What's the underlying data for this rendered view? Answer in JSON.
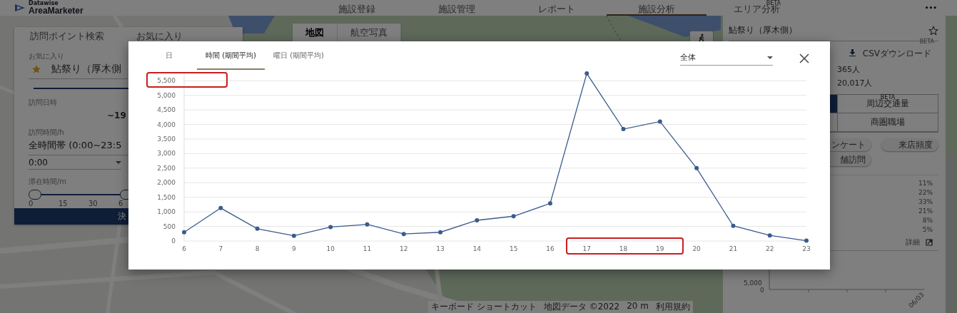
{
  "header": {
    "logo": {
      "tagline": "Datawise",
      "name": "AreaMarketer"
    },
    "nav": [
      {
        "label": "施設登録",
        "selected": false
      },
      {
        "label": "施設管理",
        "selected": false
      },
      {
        "label": "レポート",
        "selected": false
      },
      {
        "label": "施設分析",
        "selected": true
      },
      {
        "label": "エリア分析",
        "badge": "BETA",
        "selected": false
      }
    ],
    "more": "•••"
  },
  "map": {
    "view_toggle": [
      {
        "label": "地図",
        "selected": true
      },
      {
        "label": "航空写真",
        "selected": false
      }
    ],
    "attribution": [
      "キーボード ショートカット",
      "地図データ ©2022",
      "20 m",
      "利用規約"
    ]
  },
  "search_panel": {
    "tabs": [
      "訪問ポイント検索",
      "お気に入り"
    ],
    "favorite": {
      "label": "お気に入り",
      "value": "鮎祭り（厚木側"
    },
    "visit_date": {
      "label": "訪問日時",
      "value": "~19"
    },
    "visit_hours": {
      "label": "訪問時間/h",
      "value": "全時間帯 (0:00~23:5",
      "start": "0:00"
    },
    "stay_minutes": {
      "label": "滞在時間/m",
      "ticks": [
        "0",
        "15",
        "30",
        "6"
      ]
    },
    "submit": "決"
  },
  "facility_panel": {
    "title": "鮎祭り（厚木側）",
    "csv": {
      "label": "CSVダウンロード",
      "badge": "BETA"
    },
    "stats": [
      "365人",
      "20,017人"
    ],
    "tabs": [
      {
        "label": "周辺交通量",
        "badge": "BETA"
      },
      {
        "label": "商圏職場"
      }
    ],
    "chips": [
      "ンケート",
      "来店頻度",
      "舗訪問"
    ],
    "percentages": [
      "11%",
      "22%",
      "33%",
      "21%",
      "8%",
      "5%"
    ],
    "detail": "詳細",
    "mini_chart": {
      "yticks": [
        "5,000",
        "0"
      ],
      "xlabel": "06/03"
    }
  },
  "dialog": {
    "tabs": [
      {
        "label": "日",
        "selected": false
      },
      {
        "label": "時間 (期間平均)",
        "selected": true
      },
      {
        "label": "曜日 (期間平均)",
        "selected": false
      }
    ],
    "filter": "全体",
    "chart_data": {
      "type": "line",
      "x": [
        6,
        7,
        8,
        9,
        10,
        11,
        12,
        13,
        14,
        15,
        16,
        17,
        18,
        19,
        20,
        21,
        22,
        23
      ],
      "series": [
        {
          "color": "#3b5b8f",
          "marker": "circle",
          "values": [
            300,
            1130,
            420,
            180,
            480,
            570,
            240,
            300,
            710,
            850,
            1290,
            5750,
            3840,
            4100,
            2500,
            520,
            190,
            10
          ]
        }
      ],
      "xticks": [
        6,
        7,
        8,
        9,
        10,
        11,
        12,
        13,
        14,
        15,
        16,
        17,
        18,
        19,
        20,
        21,
        22,
        23
      ],
      "xlim": [
        6,
        23
      ],
      "ylim": [
        0,
        5800
      ],
      "grid": true,
      "yticks": [
        {
          "value": 0,
          "label": "0"
        },
        {
          "value": 500,
          "label": "500"
        },
        {
          "value": 1000,
          "label": "1,000"
        },
        {
          "value": 1500,
          "label": "1,500"
        },
        {
          "value": 2000,
          "label": "2,000"
        },
        {
          "value": 2500,
          "label": "2,500"
        },
        {
          "value": 3000,
          "label": "3,000"
        },
        {
          "value": 3500,
          "label": "3,500"
        },
        {
          "value": 4000,
          "label": "4,000"
        },
        {
          "value": 4500,
          "label": "4,500"
        },
        {
          "value": 5000,
          "label": "5,000"
        },
        {
          "value": 5500,
          "label": "5,500"
        }
      ]
    }
  }
}
